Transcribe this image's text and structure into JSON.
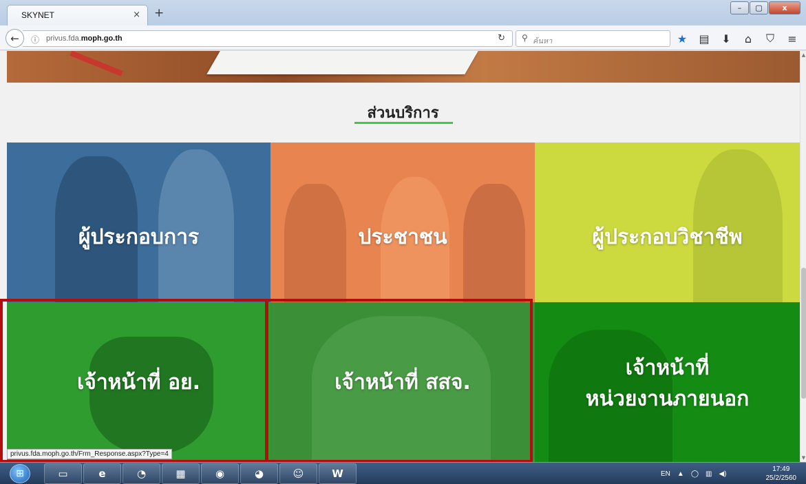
{
  "browser": {
    "tab_title": "SKYNET",
    "tab_close": "×",
    "new_tab": "+",
    "url_host_prefix": "privus.fda.",
    "url_host_bold": "moph.go.th",
    "search_placeholder": "ค้นหา",
    "window_controls": {
      "minimize": "–",
      "maximize": "▢",
      "close": "x"
    }
  },
  "page": {
    "section_title": "ส่วนบริการ",
    "tiles": [
      {
        "label": "ผู้ประกอบการ"
      },
      {
        "label": "ประชาชน"
      },
      {
        "label": "ผู้ประกอบวิชาชีพ"
      },
      {
        "label": "เจ้าหน้าที่ อย."
      },
      {
        "label": "เจ้าหน้าที่ สสจ."
      },
      {
        "label_line1": "เจ้าหน้าที่",
        "label_line2": "หน่วยงานภายนอก"
      }
    ],
    "status_url": "privus.fda.moph.go.th/Frm_Response.aspx?Type=4"
  },
  "taskbar": {
    "language": "EN",
    "time": "17:49",
    "date": "25/2/2560"
  },
  "colors": {
    "highlight": "#b30d0d",
    "title_underline": "#3fc93f"
  }
}
